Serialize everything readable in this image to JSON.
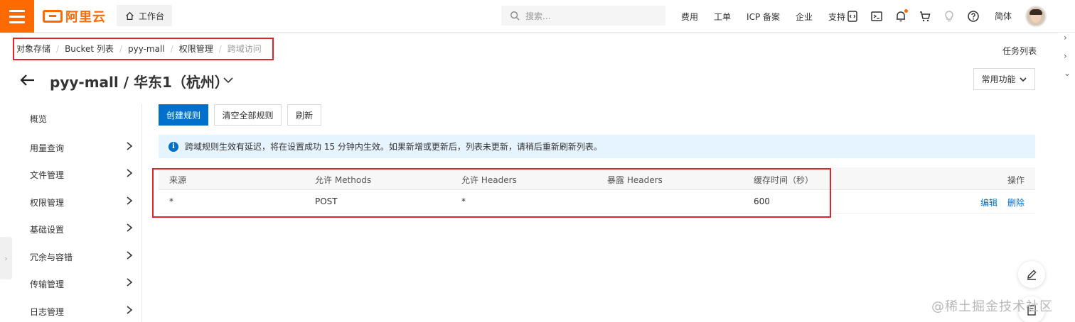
{
  "topbar": {
    "logo_text": "阿里云",
    "workbench_label": "工作台",
    "search_placeholder": "搜索...",
    "nav_links": [
      "费用",
      "工单",
      "ICP 备案",
      "企业",
      "支持"
    ],
    "language": "简体",
    "accent_color": "#ff6a00"
  },
  "breadcrumb": {
    "items": [
      "对象存储",
      "Bucket 列表",
      "pyy-mall",
      "权限管理",
      "跨域访问"
    ]
  },
  "task_list_label": "任务列表",
  "page": {
    "title": "pyy-mall / 华东1（杭州）",
    "common_functions_label": "常用功能"
  },
  "sidebar": {
    "items": [
      {
        "label": "概览",
        "has_chevron": false
      },
      {
        "label": "用量查询",
        "has_chevron": true
      },
      {
        "label": "文件管理",
        "has_chevron": true
      },
      {
        "label": "权限管理",
        "has_chevron": true
      },
      {
        "label": "基础设置",
        "has_chevron": true
      },
      {
        "label": "冗余与容错",
        "has_chevron": true
      },
      {
        "label": "传输管理",
        "has_chevron": true
      },
      {
        "label": "日志管理",
        "has_chevron": true
      }
    ]
  },
  "toolbar": {
    "create_rule_label": "创建规则",
    "clear_rules_label": "清空全部规则",
    "refresh_label": "刷新"
  },
  "notice": {
    "text": "跨域规则生效有延迟，将在设置成功 15 分钟内生效。如果新增或更新后，列表未更新，请稍后重新刷新列表。"
  },
  "table": {
    "headers": {
      "origin": "来源",
      "methods": "允许 Methods",
      "allowed_headers": "允许 Headers",
      "expose_headers": "暴露 Headers",
      "max_age": "缓存时间（秒）",
      "actions": "操作"
    },
    "rows": [
      {
        "origin": "*",
        "methods": "POST",
        "allowed_headers": "*",
        "expose_headers": "",
        "max_age": "600",
        "edit_label": "编辑",
        "delete_label": "删除"
      }
    ]
  },
  "watermark": "@稀土掘金技术社区",
  "primary_color": "#0070cc",
  "highlight_color": "#e0242c"
}
